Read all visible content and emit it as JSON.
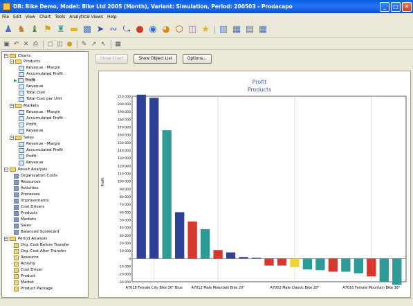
{
  "window": {
    "title": "DB: Bike Demo, Model: Bike Ltd 2005 (Month), Variant: Simulation, Period: 200503 - Prodacapo"
  },
  "menu": [
    "File",
    "Edit",
    "View",
    "Chart",
    "Tools",
    "Analytical Views",
    "Help"
  ],
  "toolbar_icons": [
    "people-icon",
    "person-walk-icon",
    "person-icon",
    "flag-icon",
    "person-group-icon",
    "folder-icon",
    "pipe-icon",
    "arrow-right-icon",
    "wave-icon",
    "curve-arrow-icon",
    "apple-icon",
    "globe-icon",
    "bowl-icon",
    "hexagon-icon",
    "cylinder-icon",
    "lightbulb-icon",
    "bar-chart-icon",
    "image-icon",
    "list-icon",
    "grid-icon"
  ],
  "toolbar2_icons": [
    "save-icon",
    "undo-icon",
    "delete-icon",
    "print-icon",
    "screen-icon",
    "copy-icon",
    "coin-icon",
    "pen-icon",
    "pointer-icon",
    "cursor-icon",
    "table-icon"
  ],
  "tree": {
    "charts": "Charts",
    "products": "Products",
    "products_items": [
      "Revenue - Margin",
      "Accumulated Profit",
      "Profit",
      "Revenue",
      "Total Cost",
      "Total Cost per Unit"
    ],
    "markets": "Markets",
    "markets_items": [
      "Revenue - Margin",
      "Accumulated Profit",
      "Profit",
      "Revenue"
    ],
    "sales": "Sales",
    "sales_items": [
      "Revenue - Margin",
      "Accumulated Profit",
      "Profit",
      "Revenue"
    ],
    "result_analysis": "Result Analysis",
    "result_items": [
      "Organization Costs",
      "Resources",
      "Activities",
      "Processes",
      "Improvements",
      "Cost Drivers",
      "Products",
      "Markets",
      "Sales",
      "Balanced Scorecard"
    ],
    "period_analysis": "Period Analysis",
    "period_items": [
      "Org. Cost Before Transfer",
      "Org. Cost After Transfer",
      "Resource",
      "Activity",
      "Cost Driver",
      "Product",
      "Market",
      "Product Package"
    ]
  },
  "buttons": {
    "show_chart": "Show Chart",
    "show_object_list": "Show Object List",
    "options": "Options..."
  },
  "chart_data": {
    "type": "bar",
    "title": "Profit",
    "subtitle": "Products",
    "ylabel": "Profit",
    "ylim": [
      -30000,
      210000
    ],
    "yticks": [
      210000,
      200000,
      190000,
      180000,
      170000,
      160000,
      150000,
      140000,
      130000,
      120000,
      110000,
      100000,
      90000,
      80000,
      70000,
      60000,
      50000,
      40000,
      30000,
      20000,
      10000,
      0,
      -10000,
      -20000,
      -30000
    ],
    "ytick_labels": [
      "210 000",
      "200 000",
      "190 000",
      "180 000",
      "170 000",
      "160 000",
      "150 000",
      "140 000",
      "130 000",
      "120 000",
      "110 000",
      "100 000",
      "90 000",
      "80 000",
      "70 000",
      "60 000",
      "50 000",
      "40 000",
      "30 000",
      "20 000",
      "10 000",
      "0",
      "-10 000",
      "-20 000",
      "-30 000"
    ],
    "xtick_labels": [
      "A7018 Female City Bike 26\" Blue",
      "A7012 Male Mountain Bike 20\"",
      "A7002 Male Classic Bike 28\"",
      "A7016 Female Mountain Bike 16\""
    ],
    "values": [
      212000,
      208000,
      166000,
      60000,
      48000,
      38000,
      11000,
      8000,
      2000,
      1000,
      -9000,
      -9000,
      -11000,
      -14000,
      -15000,
      -17000,
      -17000,
      -19000,
      -23000,
      -30000,
      -34000
    ],
    "colors": [
      "#2e3f96",
      "#2e3f96",
      "#2e9a96",
      "#2e3f96",
      "#d6372f",
      "#2e9a96",
      "#d6372f",
      "#2e3f96",
      "#2e3f96",
      "#2e3f96",
      "#d6372f",
      "#d6372f",
      "#f0d434",
      "#2e9a96",
      "#2e9a96",
      "#d6372f",
      "#2e9a96",
      "#2e9a96",
      "#d6372f",
      "#2e9a96",
      "#2e9a96"
    ],
    "grid": false
  }
}
